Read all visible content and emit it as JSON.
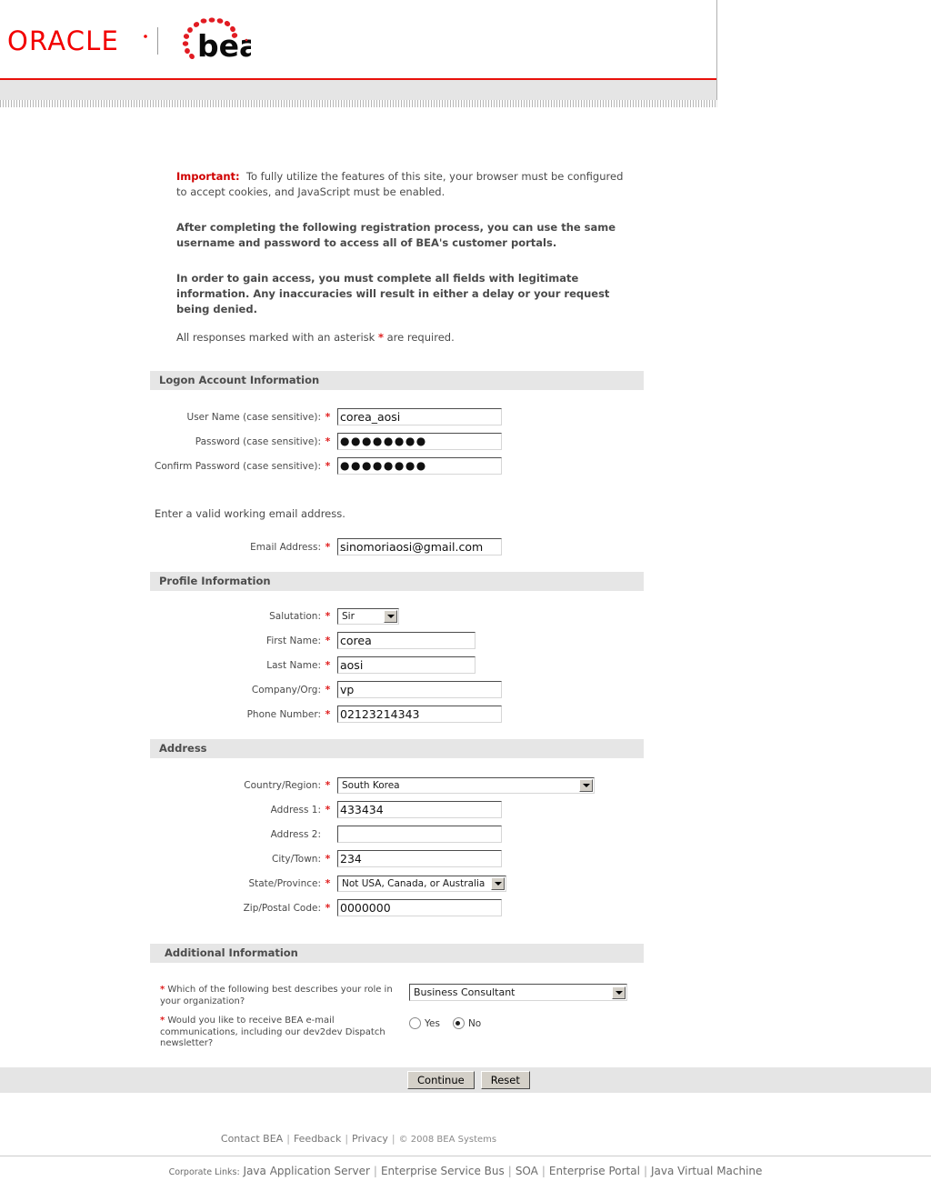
{
  "header": {
    "oracle_logo_text": "ORACLE",
    "bea_logo_text": "bea",
    "divider": "|"
  },
  "intro": {
    "important_label": "Important:",
    "important_text": "To fully utilize the features of this site, your browser must be configured to accept cookies, and JavaScript must be enabled.",
    "para_registration": "After completing the following registration process, you can use the same username and password to access all of BEA's customer portals.",
    "para_access": "In order to gain access, you must complete all fields with legitimate information. Any inaccuracies will result in either a delay or your request being denied.",
    "asterisk_note_before": "All responses marked with an asterisk",
    "asterisk_mark": "*",
    "asterisk_note_after": "are required."
  },
  "sections": {
    "logon": {
      "title": "Logon Account Information",
      "fields": {
        "username": {
          "label": "User Name (case sensitive):",
          "required": "*",
          "value": "corea_aosi"
        },
        "password": {
          "label": "Password (case sensitive):",
          "required": "*",
          "value": "●●●●●●●●"
        },
        "confirm_password": {
          "label": "Confirm Password (case sensitive):",
          "required": "*",
          "value": "●●●●●●●●"
        },
        "email": {
          "label": "Email Address:",
          "required": "*",
          "value": "sinomoriaosi@gmail.com"
        }
      },
      "email_helper": "Enter a valid working email address."
    },
    "profile": {
      "title": "Profile Information",
      "fields": {
        "salutation": {
          "label": "Salutation:",
          "required": "*",
          "value": "Sir"
        },
        "first_name": {
          "label": "First Name:",
          "required": "*",
          "value": "corea"
        },
        "last_name": {
          "label": "Last Name:",
          "required": "*",
          "value": "aosi"
        },
        "company": {
          "label": "Company/Org:",
          "required": "*",
          "value": "vp"
        },
        "phone": {
          "label": "Phone Number:",
          "required": "*",
          "value": "02123214343"
        }
      }
    },
    "address": {
      "title": "Address",
      "fields": {
        "country": {
          "label": "Country/Region:",
          "required": "*",
          "value": "South Korea"
        },
        "address1": {
          "label": "Address 1:",
          "required": "*",
          "value": "433434"
        },
        "address2": {
          "label": "Address 2:",
          "required": "",
          "value": ""
        },
        "city": {
          "label": "City/Town:",
          "required": "*",
          "value": "234"
        },
        "state": {
          "label": "State/Province:",
          "required": "*",
          "value": "Not USA, Canada, or Australia"
        },
        "zip": {
          "label": "Zip/Postal Code:",
          "required": "*",
          "value": "0000000"
        }
      }
    },
    "additional": {
      "title": "Additional Information",
      "role": {
        "required": "*",
        "question": "Which of the following best describes your role in your organization?",
        "value": "Business Consultant"
      },
      "email_optin": {
        "required": "*",
        "question": "Would you like to receive BEA e-mail communications, including our dev2dev Dispatch newsletter?",
        "option_yes": "Yes",
        "option_no": "No",
        "selected": "No"
      }
    }
  },
  "buttons": {
    "continue": "Continue",
    "reset": "Reset"
  },
  "footer": {
    "links": [
      "Contact BEA",
      "Feedback",
      "Privacy"
    ],
    "copyright": "© 2008 BEA Systems",
    "corporate_prefix": "Corporate Links:",
    "corporate_links": [
      "Java Application Server",
      "Enterprise Service Bus",
      "SOA",
      "Enterprise Portal",
      "Java Virtual Machine"
    ]
  },
  "colors": {
    "oracle_red": "#e8110b",
    "required_red": "#e02020",
    "section_bg": "#e6e6e6"
  }
}
